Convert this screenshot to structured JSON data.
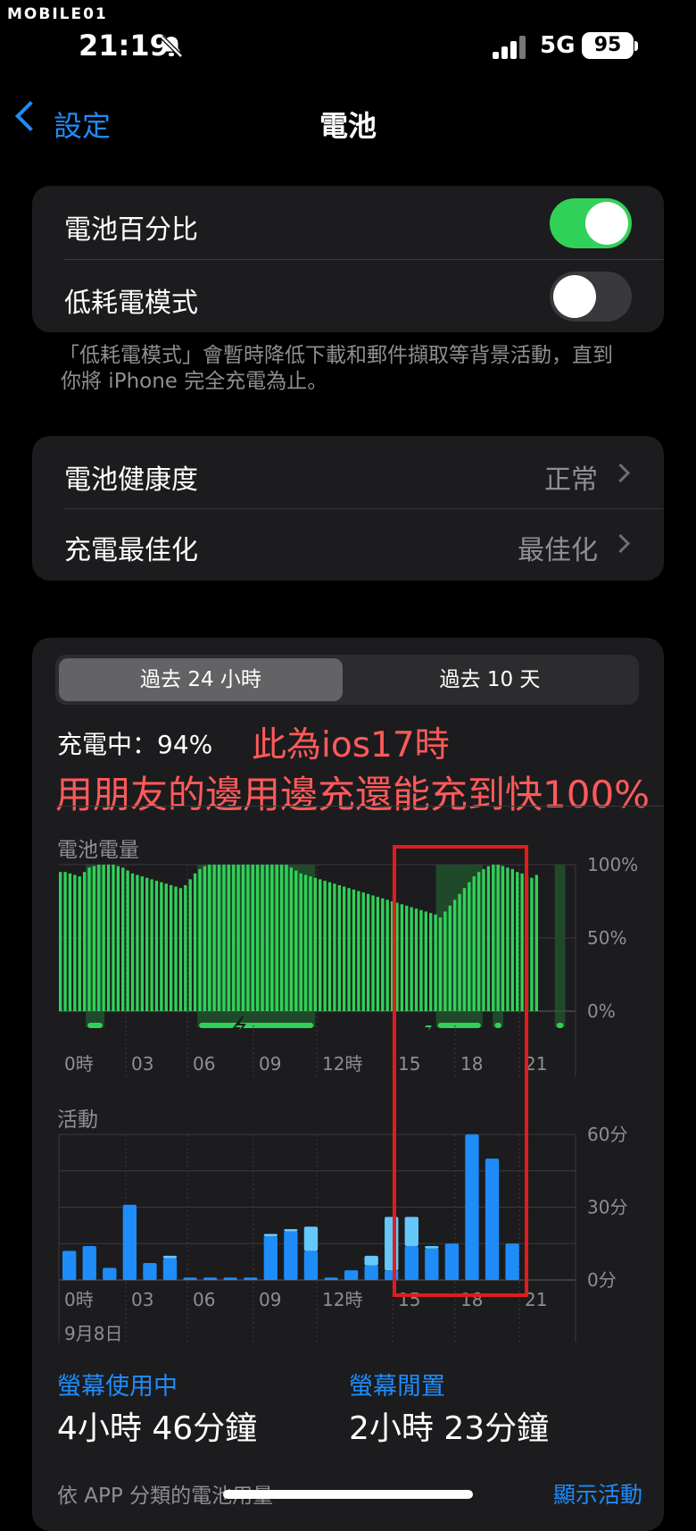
{
  "watermark": "MOBILE01",
  "status_bar": {
    "time": "21:19",
    "network": "5G",
    "battery": "95"
  },
  "nav": {
    "back_label": "設定",
    "title": "電池"
  },
  "section1": {
    "battery_percentage_label": "電池百分比",
    "battery_percentage_on": true,
    "low_power_label": "低耗電模式",
    "low_power_on": false,
    "footnote_line1": "「低耗電模式」會暫時降低下載和郵件擷取等背景活動，直到",
    "footnote_line2": "你將 iPhone 完全充電為止。"
  },
  "section2": {
    "health_label": "電池健康度",
    "health_value": "正常",
    "optimize_label": "充電最佳化",
    "optimize_value": "最佳化"
  },
  "usage": {
    "segments": [
      "過去 24 小時",
      "過去 10 天"
    ],
    "charging_status": "充電中：94%",
    "annotation_line1": "此為ios17時",
    "annotation_line2": "用朋友的邊用邊充還能充到快100%",
    "battery_level_label": "電池電量",
    "activity_label": "活動",
    "date_label": "9月8日",
    "screen_on_label": "螢幕使用中",
    "screen_on_value": "4小時 46分鐘",
    "screen_off_label": "螢幕閒置",
    "screen_off_value": "2小時 23分鐘",
    "by_app_label": "依 APP 分類的電池用量",
    "show_activity": "顯示活動"
  },
  "colors": {
    "accent": "#1e8cf9",
    "toggle_on": "#30d158",
    "battery_bar": "#30d158",
    "charging_band": "#1f4a29",
    "screen_on_bar": "#1e8cf9",
    "screen_off_bar": "#64c8fa",
    "annotation": "#ff5a5a",
    "highlight_box": "#e21b1b"
  },
  "chart_data": [
    {
      "type": "bar",
      "title": "電池電量",
      "x_ticks": [
        "0時",
        "03",
        "06",
        "09",
        "12時",
        "15",
        "18",
        "21"
      ],
      "y_ticks": [
        "100%",
        "50%",
        "0%"
      ],
      "ylim": [
        0,
        100
      ],
      "values": [
        95,
        95,
        94,
        93,
        92,
        95,
        98,
        99,
        100,
        100,
        100,
        100,
        99,
        98,
        96,
        94,
        93,
        92,
        91,
        90,
        89,
        88,
        87,
        86,
        85,
        84,
        86,
        90,
        94,
        97,
        99,
        100,
        100,
        100,
        100,
        100,
        100,
        100,
        100,
        100,
        100,
        100,
        100,
        100,
        100,
        100,
        100,
        100,
        98,
        96,
        94,
        93,
        92,
        91,
        90,
        89,
        88,
        87,
        86,
        85,
        84,
        83,
        82,
        81,
        80,
        79,
        78,
        77,
        76,
        75,
        74,
        73,
        72,
        71,
        70,
        69,
        68,
        67,
        66,
        64,
        68,
        72,
        76,
        80,
        84,
        88,
        92,
        95,
        97,
        99,
        100,
        100,
        99,
        98,
        97,
        95,
        94,
        92,
        91,
        93
      ],
      "charging_periods": [
        [
          0.052,
          0.088
        ],
        [
          0.268,
          0.496
        ],
        [
          0.73,
          0.82
        ],
        [
          0.84,
          0.86
        ],
        [
          0.96,
          0.98
        ]
      ]
    },
    {
      "type": "bar",
      "title": "活動",
      "x_ticks": [
        "0時",
        "03",
        "06",
        "09",
        "12時",
        "15",
        "18",
        "21"
      ],
      "y_ticks": [
        "60分",
        "30分",
        "0分"
      ],
      "ylim": [
        0,
        60
      ],
      "series": [
        {
          "name": "螢幕使用中",
          "values": [
            12,
            14,
            5,
            31,
            7,
            9,
            1,
            1,
            1,
            1,
            18,
            20,
            12,
            1,
            4,
            6,
            4,
            14,
            13,
            15,
            60,
            50,
            15
          ]
        },
        {
          "name": "螢幕閒置",
          "values": [
            0,
            0,
            0,
            0,
            0,
            1,
            0,
            0,
            0,
            0,
            1,
            1,
            10,
            0,
            0,
            4,
            22,
            12,
            1,
            0,
            0,
            0,
            0
          ]
        }
      ]
    }
  ]
}
